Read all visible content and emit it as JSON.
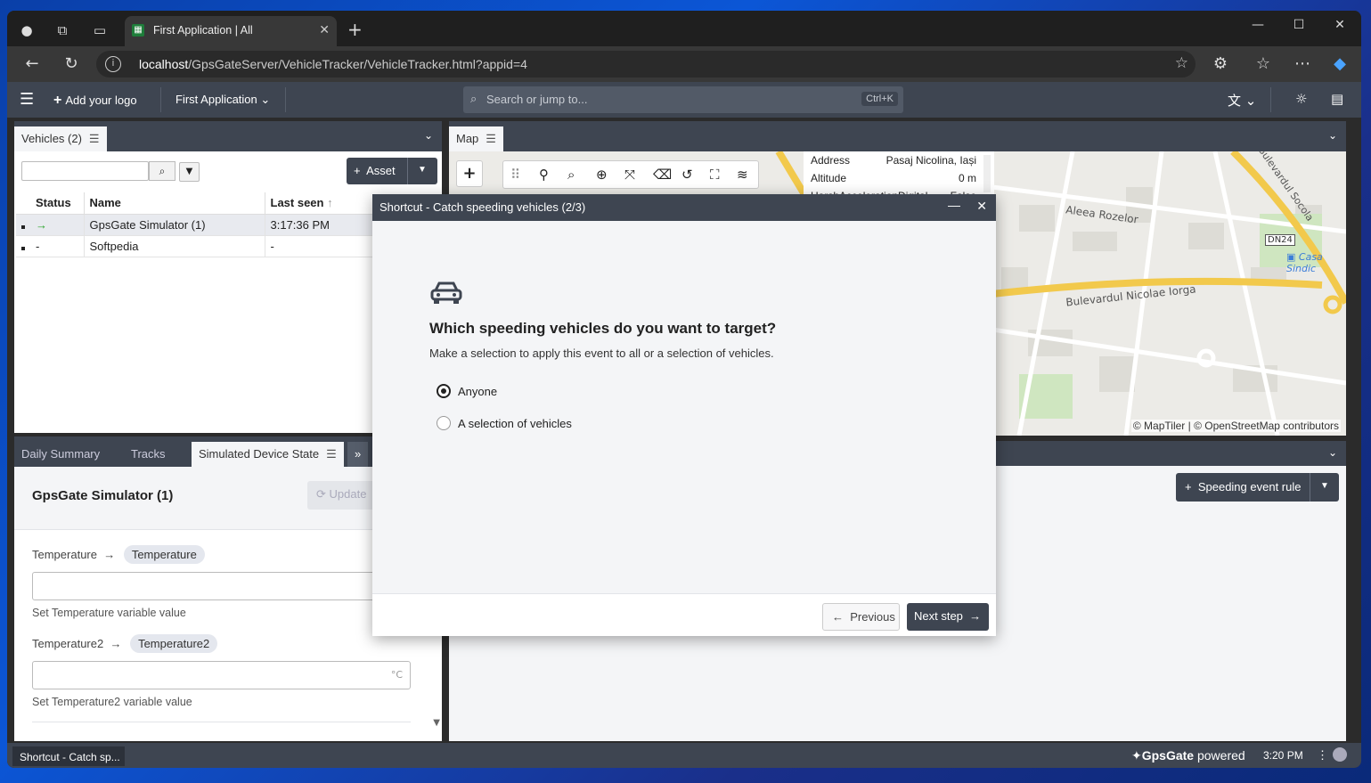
{
  "browser": {
    "tab_title": "First Application | All",
    "url_host": "localhost",
    "url_path": "/GpsGateServer/VehicleTracker/VehicleTracker.html?appid=4"
  },
  "header": {
    "add_logo": "Add your logo",
    "app_name": "First Application",
    "search_placeholder": "Search or jump to...",
    "search_shortcut": "Ctrl+K"
  },
  "vehicles_panel": {
    "tab_label": "Vehicles (2)",
    "asset_button": "Asset",
    "columns": [
      "Status",
      "Name",
      "Last seen"
    ],
    "rows": [
      {
        "status": "→",
        "name": "GpsGate Simulator (1)",
        "last_seen": "3:17:36 PM"
      },
      {
        "status": "-",
        "name": "Softpedia",
        "last_seen": "-"
      }
    ]
  },
  "bottom_panel": {
    "tabs": [
      "Daily Summary",
      "Tracks",
      "Simulated Device State"
    ],
    "device_title": "GpsGate Simulator (1)",
    "update_button": "Update",
    "fields": [
      {
        "label": "Temperature",
        "chip": "Temperature",
        "help": "Set Temperature variable value",
        "unit": ""
      },
      {
        "label": "Temperature2",
        "chip": "Temperature2",
        "help": "Set Temperature2 variable value",
        "unit": "°C"
      }
    ]
  },
  "map_panel": {
    "tab_label": "Map",
    "attribution": "© MapTiler | © OpenStreetMap contributors",
    "info": [
      {
        "key": "Address",
        "value": "Pasaj Nicolina, Iași"
      },
      {
        "key": "Altitude",
        "value": "0 m"
      },
      {
        "key": "HarshAccelerationDigital",
        "value": "False"
      }
    ],
    "map_labels": {
      "street1": "Aleea Rozelor",
      "street2": "Bulevardul Nicolae Iorga",
      "street3": "Bulevardul Socola",
      "road": "DN24",
      "poi": "Casa Sindic"
    }
  },
  "rules_panel": {
    "button": "Speeding event rule"
  },
  "modal": {
    "title": "Shortcut - Catch speeding vehicles (2/3)",
    "question": "Which speeding vehicles do you want to target?",
    "subtitle": "Make a selection to apply this event to all or a selection of vehicles.",
    "options": [
      {
        "label": "Anyone",
        "selected": true
      },
      {
        "label": "A selection of vehicles",
        "selected": false
      }
    ],
    "previous": "Previous",
    "next": "Next step"
  },
  "statusbar": {
    "task": "Shortcut - Catch sp...",
    "brand_bold": "GpsGate",
    "brand_rest": "powered",
    "time": "3:20 PM"
  },
  "colors": {
    "header": "#3e4551",
    "accent": "#2aa52a"
  }
}
